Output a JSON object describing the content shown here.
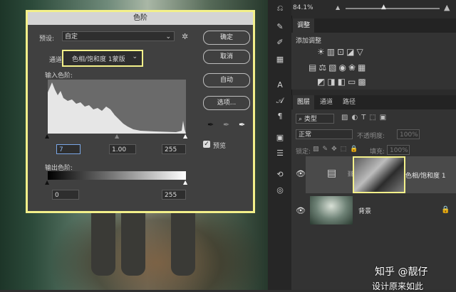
{
  "dialog": {
    "title": "色阶",
    "preset_label": "预设:",
    "preset_value": "自定",
    "channel_label": "通道:",
    "channel_value": "色相/饱和度 1蒙版",
    "input_levels_label": "输入色阶:",
    "input_black": "7",
    "input_gamma": "1.00",
    "input_white": "255",
    "output_levels_label": "输出色阶:",
    "output_black": "0",
    "output_white": "255",
    "buttons": {
      "ok": "确定",
      "cancel": "取消",
      "auto": "自动",
      "options": "选项..."
    },
    "preview_label": "预览",
    "preview_checked": true
  },
  "top": {
    "zoom": "84.1%"
  },
  "adjustments": {
    "tab": "调整",
    "add_label": "添加调整"
  },
  "layers_panel": {
    "tabs": [
      "图层",
      "通道",
      "路径"
    ],
    "filter_label": "类型",
    "blend_mode": "正常",
    "opacity_label": "不透明度:",
    "opacity_value": "100%",
    "lock_label": "锁定:",
    "fill_label": "填充:",
    "fill_value": "100%",
    "layers": [
      {
        "name": "色相/饱和度 1",
        "visible": true
      },
      {
        "name": "背景",
        "visible": true,
        "locked": true
      }
    ]
  },
  "watermark": {
    "line1": "知乎 @靓仔",
    "line2": "设计原来如此"
  },
  "colors": {
    "highlight": "#f3f08a",
    "panel": "#2b2b2b",
    "dialog": "#404040"
  }
}
